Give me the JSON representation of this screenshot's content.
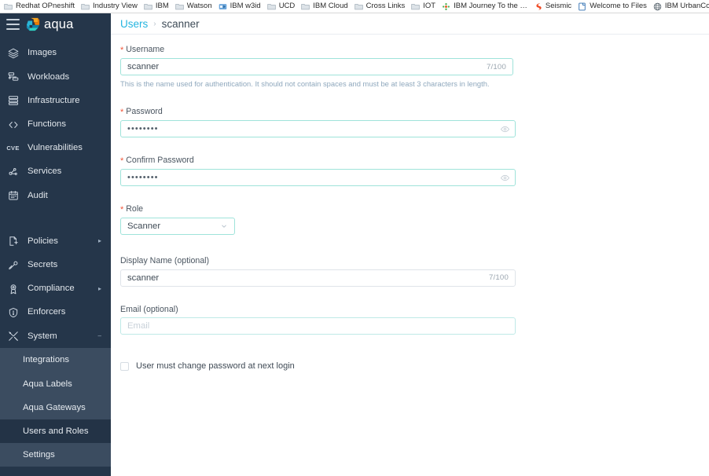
{
  "browser": {
    "bookmarks": [
      {
        "label": "Redhat OPneshift",
        "icon": "folder-icon"
      },
      {
        "label": "Industry View",
        "icon": "folder-icon"
      },
      {
        "label": "IBM",
        "icon": "folder-icon"
      },
      {
        "label": "Watson",
        "icon": "folder-icon"
      },
      {
        "label": "IBM w3id",
        "icon": "site-icon-w3id"
      },
      {
        "label": "UCD",
        "icon": "folder-icon"
      },
      {
        "label": "IBM Cloud",
        "icon": "folder-icon"
      },
      {
        "label": "Cross Links",
        "icon": "folder-icon"
      },
      {
        "label": "IOT",
        "icon": "folder-icon"
      },
      {
        "label": "IBM Journey To the …",
        "icon": "site-icon-journey"
      },
      {
        "label": "Seismic",
        "icon": "site-icon-seismic"
      },
      {
        "label": "Welcome to Files",
        "icon": "document-icon"
      },
      {
        "label": "IBM UrbanCode De…",
        "icon": "globe-icon"
      }
    ]
  },
  "sidebar": {
    "brand": "aqua",
    "menu_icon": "hamburger-icon",
    "items": [
      {
        "label": "Images",
        "icon": "layers-icon",
        "caret": ""
      },
      {
        "label": "Workloads",
        "icon": "workloads-icon",
        "caret": ""
      },
      {
        "label": "Infrastructure",
        "icon": "server-icon",
        "caret": ""
      },
      {
        "label": "Functions",
        "icon": "code-icon",
        "caret": ""
      },
      {
        "label": "Vulnerabilities",
        "icon": "cve-icon",
        "caret": ""
      },
      {
        "label": "Services",
        "icon": "services-icon",
        "caret": ""
      },
      {
        "label": "Audit",
        "icon": "calendar-icon",
        "caret": ""
      }
    ],
    "items2": [
      {
        "label": "Policies",
        "icon": "policies-icon",
        "caret": "▸"
      },
      {
        "label": "Secrets",
        "icon": "key-icon",
        "caret": ""
      },
      {
        "label": "Compliance",
        "icon": "badge-icon",
        "caret": "▸"
      },
      {
        "label": "Enforcers",
        "icon": "shield-icon",
        "caret": ""
      },
      {
        "label": "System",
        "icon": "tools-icon",
        "caret": "–"
      }
    ],
    "submenu": [
      {
        "label": "Integrations",
        "active": false
      },
      {
        "label": "Aqua Labels",
        "active": false
      },
      {
        "label": "Aqua Gateways",
        "active": false
      },
      {
        "label": "Users and Roles",
        "active": true
      },
      {
        "label": "Settings",
        "active": false
      }
    ]
  },
  "breadcrumb": {
    "root": "Users",
    "separator": "›",
    "current": "scanner"
  },
  "form": {
    "username": {
      "label": "Username",
      "required_marker": "*",
      "value": "scanner",
      "counter": "7/100",
      "helper": "This is the name used for authentication. It should not contain spaces and must be at least 3 characters in length."
    },
    "password": {
      "label": "Password",
      "required_marker": "*",
      "masked": "••••••••",
      "toggle_icon": "eye-icon"
    },
    "confirm_password": {
      "label": "Confirm Password",
      "required_marker": "*",
      "masked": "••••••••",
      "toggle_icon": "eye-icon"
    },
    "role": {
      "label": "Role",
      "required_marker": "*",
      "value": "Scanner",
      "chevron_icon": "chevron-down-icon"
    },
    "display_name": {
      "label": "Display Name (optional)",
      "value": "scanner",
      "counter": "7/100"
    },
    "email": {
      "label": "Email (optional)",
      "value": "",
      "placeholder": "Email"
    },
    "force_change": {
      "label": "User must change password at next login",
      "checked": false
    }
  },
  "colors": {
    "sidebar_bg": "#25364a",
    "submenu_bg": "#3b4c60",
    "submenu_active_bg": "#233346",
    "link_accent": "#25b5e0",
    "required_marker": "#f0563a",
    "input_border_active": "#9fe3da",
    "helper_text": "#8fa8bd"
  }
}
